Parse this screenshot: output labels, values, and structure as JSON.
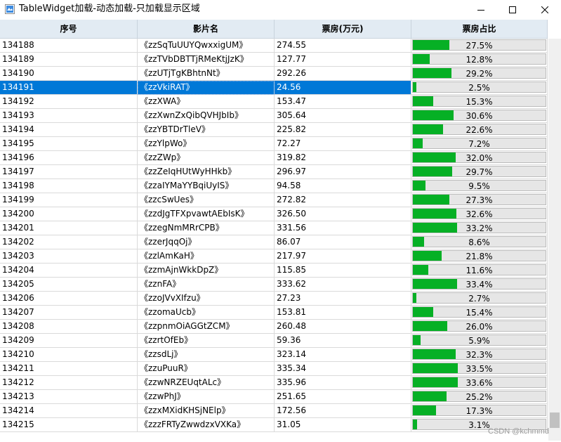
{
  "window": {
    "title": "TableWidget加载-动态加载-只加载显示区域",
    "minimize_icon": "minimize-icon",
    "maximize_icon": "maximize-icon",
    "close_icon": "close-icon"
  },
  "table": {
    "headers": [
      "序号",
      "影片名",
      "票房(万元)",
      "票房占比"
    ],
    "selected_row_index": 3,
    "progress_color": "#06b025",
    "selection_color": "#0078d7",
    "header_bg": "#e2ebf3",
    "rows": [
      {
        "id": "134188",
        "name": "《zzSqTuUUYQwxxigUM》",
        "box": "274.55",
        "pct_text": "27.5%",
        "pct": 0.275
      },
      {
        "id": "134189",
        "name": "《zzTVbDBTTjRMeKtjJzK》",
        "box": "127.77",
        "pct_text": "12.8%",
        "pct": 0.128
      },
      {
        "id": "134190",
        "name": "《zzUTjTgKBhtnNt》",
        "box": "292.26",
        "pct_text": "29.2%",
        "pct": 0.292
      },
      {
        "id": "134191",
        "name": "《zzVkiRAT》",
        "box": "24.56",
        "pct_text": "2.5%",
        "pct": 0.025
      },
      {
        "id": "134192",
        "name": "《zzXWA》",
        "box": "153.47",
        "pct_text": "15.3%",
        "pct": 0.153
      },
      {
        "id": "134193",
        "name": "《zzXwnZxQibQVHJbIb》",
        "box": "305.64",
        "pct_text": "30.6%",
        "pct": 0.306
      },
      {
        "id": "134194",
        "name": "《zzYBTDrTleV》",
        "box": "225.82",
        "pct_text": "22.6%",
        "pct": 0.226
      },
      {
        "id": "134195",
        "name": "《zzYlpWo》",
        "box": "72.27",
        "pct_text": "7.2%",
        "pct": 0.072
      },
      {
        "id": "134196",
        "name": "《zzZWp》",
        "box": "319.82",
        "pct_text": "32.0%",
        "pct": 0.32
      },
      {
        "id": "134197",
        "name": "《zzZeIqHUtWyHHkb》",
        "box": "296.97",
        "pct_text": "29.7%",
        "pct": 0.297
      },
      {
        "id": "134198",
        "name": "《zzaIYMaYYBqiUyIS》",
        "box": "94.58",
        "pct_text": "9.5%",
        "pct": 0.095
      },
      {
        "id": "134199",
        "name": "《zzcSwUes》",
        "box": "272.82",
        "pct_text": "27.3%",
        "pct": 0.273
      },
      {
        "id": "134200",
        "name": "《zzdJgTFXpvawtAEbIsK》",
        "box": "326.50",
        "pct_text": "32.6%",
        "pct": 0.326
      },
      {
        "id": "134201",
        "name": "《zzegNmMRrCPB》",
        "box": "331.56",
        "pct_text": "33.2%",
        "pct": 0.332
      },
      {
        "id": "134202",
        "name": "《zzerJqqOj》",
        "box": "86.07",
        "pct_text": "8.6%",
        "pct": 0.086
      },
      {
        "id": "134203",
        "name": "《zzlAmKaH》",
        "box": "217.97",
        "pct_text": "21.8%",
        "pct": 0.218
      },
      {
        "id": "134204",
        "name": "《zzmAjnWkkDpZ》",
        "box": "115.85",
        "pct_text": "11.6%",
        "pct": 0.116
      },
      {
        "id": "134205",
        "name": "《zznFA》",
        "box": "333.62",
        "pct_text": "33.4%",
        "pct": 0.334
      },
      {
        "id": "134206",
        "name": "《zzoJVvXIfzu》",
        "box": "27.23",
        "pct_text": "2.7%",
        "pct": 0.027
      },
      {
        "id": "134207",
        "name": "《zzomaUcb》",
        "box": "153.81",
        "pct_text": "15.4%",
        "pct": 0.154
      },
      {
        "id": "134208",
        "name": "《zzpnmOiAGGtZCM》",
        "box": "260.48",
        "pct_text": "26.0%",
        "pct": 0.26
      },
      {
        "id": "134209",
        "name": "《zzrtOfEb》",
        "box": "59.36",
        "pct_text": "5.9%",
        "pct": 0.059
      },
      {
        "id": "134210",
        "name": "《zzsdLj》",
        "box": "323.14",
        "pct_text": "32.3%",
        "pct": 0.323
      },
      {
        "id": "134211",
        "name": "《zzuPuuR》",
        "box": "335.34",
        "pct_text": "33.5%",
        "pct": 0.335
      },
      {
        "id": "134212",
        "name": "《zzwNRZEUqtALc》",
        "box": "335.96",
        "pct_text": "33.6%",
        "pct": 0.336
      },
      {
        "id": "134213",
        "name": "《zzwPhJ》",
        "box": "251.65",
        "pct_text": "25.2%",
        "pct": 0.252
      },
      {
        "id": "134214",
        "name": "《zzxMXidKHSjNElp》",
        "box": "172.56",
        "pct_text": "17.3%",
        "pct": 0.173
      },
      {
        "id": "134215",
        "name": "《zzzFRTyZwwdzxVXKa》",
        "box": "31.05",
        "pct_text": "3.1%",
        "pct": 0.031
      }
    ]
  },
  "watermark": "CSDN @kchmmd"
}
